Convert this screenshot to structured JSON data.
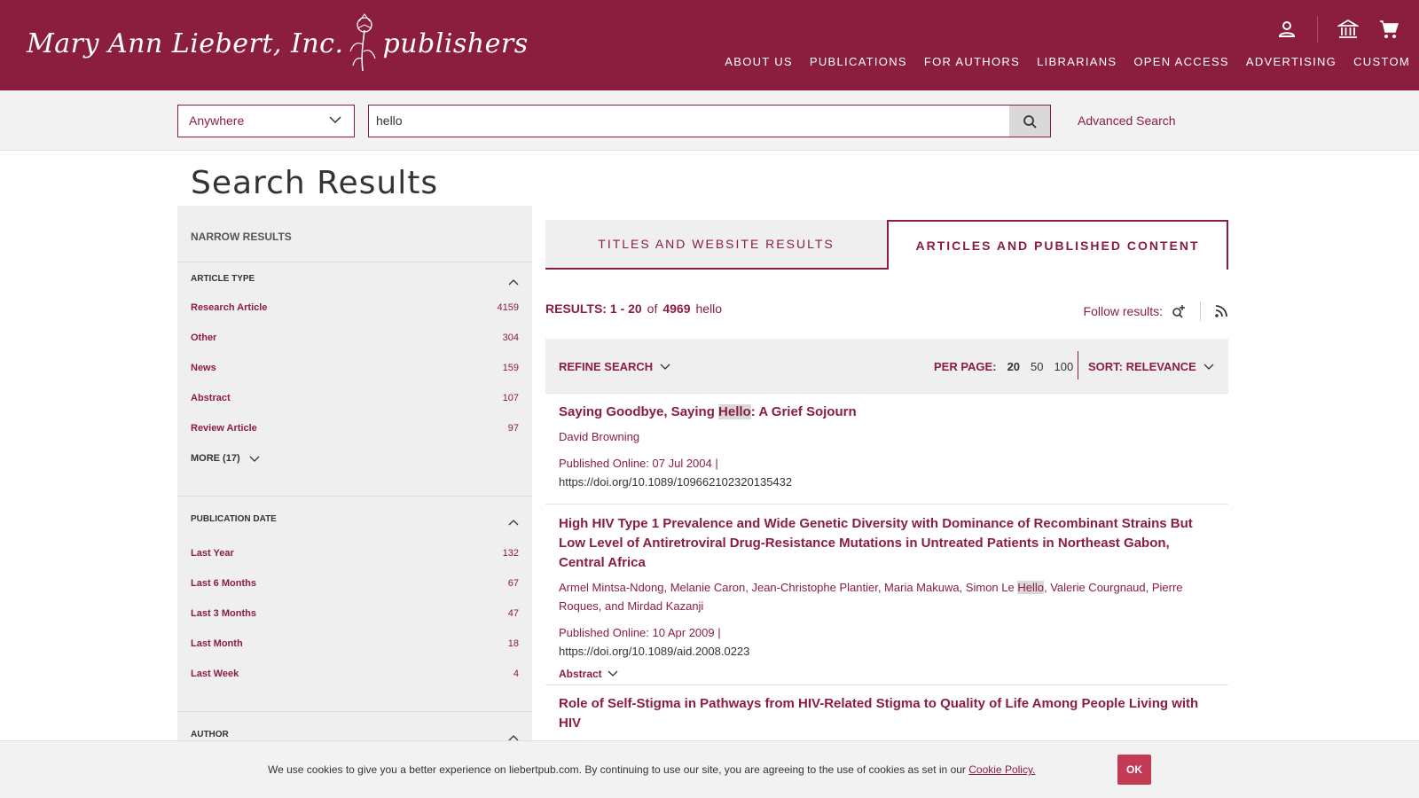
{
  "header": {
    "logo_left": "Mary Ann Liebert, Inc.",
    "logo_right": "publishers",
    "icons": [
      "user-icon",
      "institution-icon",
      "cart-icon"
    ],
    "nav": [
      "ABOUT US",
      "PUBLICATIONS",
      "FOR AUTHORS",
      "LIBRARIANS",
      "OPEN ACCESS",
      "ADVERTISING",
      "CUSTOM"
    ]
  },
  "search": {
    "scope": "Anywhere",
    "query": "hello",
    "advanced": "Advanced Search"
  },
  "page_title": "Search Results",
  "sidebar": {
    "heading": "NARROW RESULTS",
    "article_type": {
      "title": "ARTICLE TYPE",
      "items": [
        {
          "label": "Research Article",
          "count": "4159"
        },
        {
          "label": "Other",
          "count": "304"
        },
        {
          "label": "News",
          "count": "159"
        },
        {
          "label": "Abstract",
          "count": "107"
        },
        {
          "label": "Review Article",
          "count": "97"
        }
      ],
      "more": "MORE (17)"
    },
    "publication_date": {
      "title": "PUBLICATION DATE",
      "items": [
        {
          "label": "Last Year",
          "count": "132"
        },
        {
          "label": "Last 6 Months",
          "count": "67"
        },
        {
          "label": "Last 3 Months",
          "count": "47"
        },
        {
          "label": "Last Month",
          "count": "18"
        },
        {
          "label": "Last Week",
          "count": "4"
        }
      ]
    },
    "author": {
      "title": "AUTHOR"
    }
  },
  "tabs": {
    "titles": "TITLES AND WEBSITE RESULTS",
    "articles": "ARTICLES AND PUBLISHED CONTENT"
  },
  "results_summary": {
    "label": "RESULTS: 1 - 20",
    "of": "of",
    "total": "4969",
    "query": "hello",
    "follow": "Follow results:"
  },
  "refine": {
    "label": "REFINE SEARCH",
    "per_page_label": "PER PAGE:",
    "per_page_options": [
      "20",
      "50",
      "100"
    ],
    "sort": "SORT: RELEVANCE"
  },
  "results": [
    {
      "title_pre": "Saying Goodbye, Saying ",
      "title_hl": "Hello",
      "title_post": ": A Grief Sojourn",
      "authors_pre": "David Browning",
      "published": "Published Online: 07 Jul 2004  |",
      "doi": "https://doi.org/10.1089/109662102320135432"
    },
    {
      "title": "High HIV Type 1 Prevalence and Wide Genetic Diversity with Dominance of Recombinant Strains But Low Level of Antiretroviral Drug-Resistance Mutations in Untreated Patients in Northeast Gabon, Central Africa",
      "authors_pre": "Armel Mintsa-Ndong, Melanie Caron, Jean-Christophe Plantier, Maria Makuwa, Simon Le ",
      "authors_hl": "Hello",
      "authors_post": ", Valerie Courgnaud, Pierre Roques, and Mirdad Kazanji",
      "published": "Published Online: 10 Apr 2009  |",
      "doi": "https://doi.org/10.1089/aid.2008.0223",
      "abstract": "Abstract"
    },
    {
      "title": "Role of Self-Stigma in Pathways from HIV-Related Stigma to Quality of Life Among People Living with HIV"
    }
  ],
  "cookie": {
    "text": "We use cookies to give you a better experience on liebertpub.com. By continuing to use our site, you are agreeing to the use of cookies as set in our ",
    "link": "Cookie Policy.",
    "ok": "OK"
  },
  "colors": {
    "brand": "#8b1e3f",
    "panel": "#f0efef",
    "ok_button": "#c23a53"
  }
}
